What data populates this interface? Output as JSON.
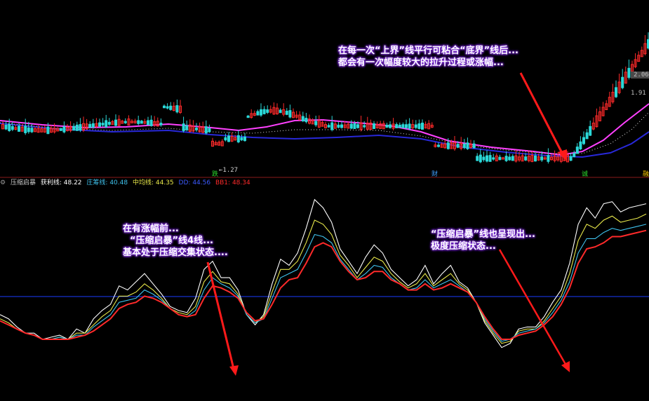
{
  "indicator_bar": {
    "icon": "gear-icon",
    "name": "压缩启暴",
    "items": [
      {
        "label": "获利线",
        "value": "48.22",
        "color": "#ffffff"
      },
      {
        "label": "庄筹线",
        "value": "40.48",
        "color": "#3fc3ee"
      },
      {
        "label": "中均线",
        "value": "44.35",
        "color": "#e8e84a"
      },
      {
        "label": "DD",
        "value": "44.56",
        "color": "#3c5bff"
      },
      {
        "label": "BB1",
        "value": "48.34",
        "color": "#ff2a2a"
      }
    ]
  },
  "callouts": {
    "top_right": [
      "在每一次“上界”线平行可粘合“底界”线后...",
      "都会有一次幅度较大的拉升过程或涨幅..."
    ],
    "bottom_left": [
      "在有涨幅前...",
      "“压缩启暴”线4线...",
      "基本处于压缩交集状态...."
    ],
    "bottom_right": [
      "“压缩启暴”线也呈现出...",
      "极度压缩状态..."
    ]
  },
  "price_labels": {
    "low": "←1.27",
    "high_a": "2.06",
    "high_b": "1.91"
  },
  "tags": [
    {
      "text": "跌",
      "color": "#2bd82b"
    },
    {
      "text": "财",
      "color": "#3fa0ff"
    },
    {
      "text": "诚",
      "color": "#2bd82b"
    },
    {
      "text": "融",
      "color": "#ffcc00"
    }
  ],
  "colors": {
    "up": "#ff2a2a",
    "down": "#2bd8d8",
    "ma_magenta": "#ff40ff",
    "ma_blue": "#2828d8",
    "ma_dots": "#e0e0e0",
    "arrow": "#ff1a1a",
    "callout_glow": "#7a2bd6",
    "hline": "#1a3cff"
  },
  "chart_data": [
    {
      "type": "candlestick",
      "lines": [
        "magenta moving average",
        "blue moving average",
        "white dotted line"
      ]
    },
    {
      "type": "line",
      "series": [
        {
          "name": "获利线",
          "color": "#ffffff",
          "values": [
            40,
            38,
            34,
            31,
            31,
            28,
            29,
            30,
            28,
            33,
            31,
            38,
            42,
            45,
            54,
            52,
            56,
            60,
            55,
            50,
            44,
            42,
            41,
            48,
            62,
            66,
            58,
            58,
            52,
            40,
            35,
            40,
            55,
            67,
            64,
            70,
            82,
            96,
            92,
            85,
            72,
            66,
            60,
            68,
            74,
            70,
            62,
            58,
            54,
            57,
            64,
            55,
            60,
            64,
            56,
            53,
            46,
            36,
            30,
            24,
            26,
            33,
            34,
            34,
            39,
            46,
            52,
            65,
            84,
            92,
            87,
            94,
            95,
            90,
            92,
            93,
            94
          ]
        },
        {
          "name": "中均线",
          "color": "#e8e84a",
          "values": [
            38,
            36,
            33,
            31,
            30,
            28,
            28,
            29,
            28,
            31,
            31,
            35,
            39,
            42,
            49,
            49,
            51,
            55,
            52,
            48,
            43,
            41,
            40,
            44,
            56,
            61,
            56,
            55,
            50,
            40,
            36,
            39,
            51,
            62,
            62,
            66,
            75,
            86,
            84,
            79,
            69,
            64,
            58,
            63,
            68,
            66,
            60,
            56,
            53,
            55,
            60,
            54,
            57,
            60,
            55,
            52,
            46,
            37,
            31,
            26,
            27,
            32,
            33,
            33,
            37,
            43,
            49,
            60,
            76,
            84,
            82,
            86,
            88,
            85,
            86,
            87,
            89
          ]
        },
        {
          "name": "庄筹线",
          "color": "#3fc3ee",
          "values": [
            37,
            35,
            33,
            31,
            30,
            28,
            28,
            29,
            28,
            30,
            30,
            34,
            37,
            40,
            46,
            47,
            48,
            52,
            50,
            47,
            43,
            40,
            39,
            42,
            52,
            58,
            55,
            53,
            49,
            40,
            36,
            38,
            48,
            58,
            60,
            62,
            70,
            79,
            78,
            75,
            67,
            62,
            57,
            60,
            64,
            63,
            58,
            55,
            52,
            53,
            57,
            53,
            55,
            57,
            54,
            51,
            46,
            38,
            32,
            27,
            28,
            31,
            32,
            33,
            36,
            41,
            47,
            56,
            70,
            77,
            77,
            80,
            82,
            81,
            82,
            83,
            84
          ]
        },
        {
          "name": "BB1",
          "color": "#ff2a2a",
          "values": [
            37,
            35,
            33,
            31,
            30,
            28,
            28,
            28,
            28,
            29,
            30,
            32,
            35,
            38,
            43,
            45,
            46,
            49,
            48,
            46,
            43,
            40,
            39,
            40,
            48,
            54,
            53,
            51,
            48,
            41,
            37,
            38,
            45,
            53,
            57,
            58,
            65,
            73,
            75,
            73,
            66,
            61,
            57,
            58,
            61,
            61,
            57,
            55,
            52,
            52,
            55,
            52,
            53,
            55,
            53,
            51,
            46,
            39,
            33,
            28,
            28,
            30,
            31,
            32,
            35,
            39,
            45,
            53,
            65,
            72,
            73,
            75,
            78,
            78,
            79,
            80,
            81
          ]
        }
      ]
    }
  ]
}
